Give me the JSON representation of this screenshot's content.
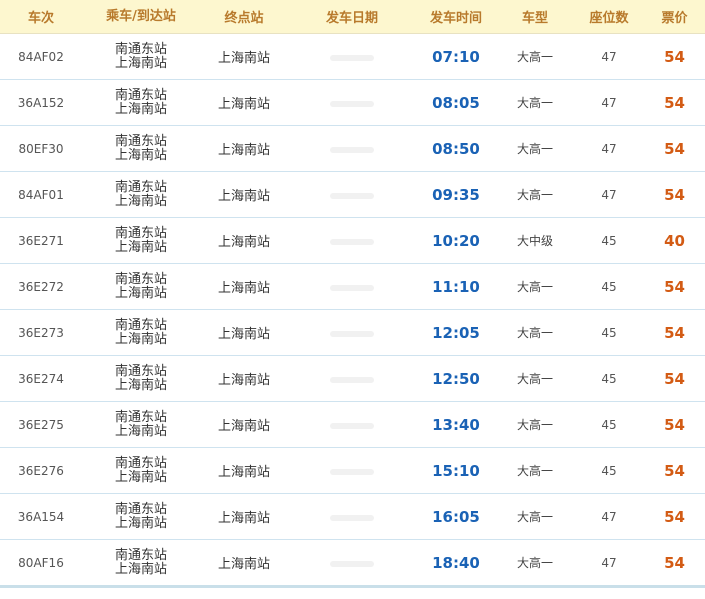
{
  "headers": {
    "id": "车次",
    "route": "乘车/到达站",
    "dest": "终点站",
    "date": "发车日期",
    "time": "发车时间",
    "type": "车型",
    "seats": "座位数",
    "price": "票价"
  },
  "rows": [
    {
      "id": "84AF02",
      "from": "南通东站",
      "to": "上海南站",
      "dest": "上海南站",
      "time": "07:10",
      "type": "大高一",
      "seats": "47",
      "price": "54"
    },
    {
      "id": "36A152",
      "from": "南通东站",
      "to": "上海南站",
      "dest": "上海南站",
      "time": "08:05",
      "type": "大高一",
      "seats": "47",
      "price": "54"
    },
    {
      "id": "80EF30",
      "from": "南通东站",
      "to": "上海南站",
      "dest": "上海南站",
      "time": "08:50",
      "type": "大高一",
      "seats": "47",
      "price": "54"
    },
    {
      "id": "84AF01",
      "from": "南通东站",
      "to": "上海南站",
      "dest": "上海南站",
      "time": "09:35",
      "type": "大高一",
      "seats": "47",
      "price": "54"
    },
    {
      "id": "36E271",
      "from": "南通东站",
      "to": "上海南站",
      "dest": "上海南站",
      "time": "10:20",
      "type": "大中级",
      "seats": "45",
      "price": "40"
    },
    {
      "id": "36E272",
      "from": "南通东站",
      "to": "上海南站",
      "dest": "上海南站",
      "time": "11:10",
      "type": "大高一",
      "seats": "45",
      "price": "54"
    },
    {
      "id": "36E273",
      "from": "南通东站",
      "to": "上海南站",
      "dest": "上海南站",
      "time": "12:05",
      "type": "大高一",
      "seats": "45",
      "price": "54"
    },
    {
      "id": "36E274",
      "from": "南通东站",
      "to": "上海南站",
      "dest": "上海南站",
      "time": "12:50",
      "type": "大高一",
      "seats": "45",
      "price": "54"
    },
    {
      "id": "36E275",
      "from": "南通东站",
      "to": "上海南站",
      "dest": "上海南站",
      "time": "13:40",
      "type": "大高一",
      "seats": "45",
      "price": "54"
    },
    {
      "id": "36E276",
      "from": "南通东站",
      "to": "上海南站",
      "dest": "上海南站",
      "time": "15:10",
      "type": "大高一",
      "seats": "45",
      "price": "54"
    },
    {
      "id": "36A154",
      "from": "南通东站",
      "to": "上海南站",
      "dest": "上海南站",
      "time": "16:05",
      "type": "大高一",
      "seats": "47",
      "price": "54"
    },
    {
      "id": "80AF16",
      "from": "南通东站",
      "to": "上海南站",
      "dest": "上海南站",
      "time": "18:40",
      "type": "大高一",
      "seats": "47",
      "price": "54"
    }
  ]
}
